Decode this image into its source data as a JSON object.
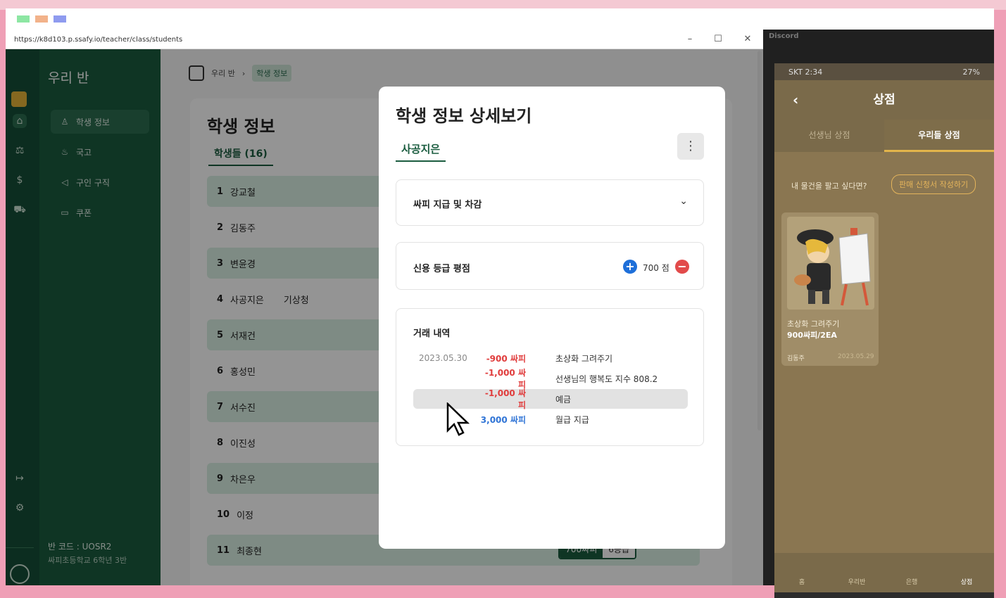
{
  "browser": {
    "url": "https://k8d103.p.ssafy.io/teacher/class/students"
  },
  "sidebar": {
    "title": "우리 반",
    "items": [
      {
        "label": "학생 정보",
        "icon": "person-icon",
        "active": true
      },
      {
        "label": "국고",
        "icon": "piggy-bank-icon"
      },
      {
        "label": "구인 구직",
        "icon": "megaphone-icon"
      },
      {
        "label": "쿠폰",
        "icon": "ticket-icon"
      }
    ],
    "class_code": "반 코드 : UOSR2",
    "school": "싸피초등학교 6학년 3반"
  },
  "breadcrumb": {
    "root": "우리 반",
    "current": "학생 정보"
  },
  "students_page": {
    "title": "학생 정보",
    "tab": "학생들 (16)",
    "rows": [
      {
        "no": "1",
        "name": "강교철"
      },
      {
        "no": "2",
        "name": "김동주"
      },
      {
        "no": "3",
        "name": "변윤경"
      },
      {
        "no": "4",
        "name": "사공지은",
        "extra": "기상청"
      },
      {
        "no": "5",
        "name": "서재건"
      },
      {
        "no": "6",
        "name": "홍성민"
      },
      {
        "no": "7",
        "name": "서수진"
      },
      {
        "no": "8",
        "name": "이진성"
      },
      {
        "no": "9",
        "name": "차은우"
      },
      {
        "no": "10",
        "name": "이정"
      },
      {
        "no": "11",
        "name": "최종현",
        "balance": "700싸피",
        "grade": "6등급"
      }
    ]
  },
  "modal": {
    "title": "학생 정보 상세보기",
    "student": "사공지은",
    "sections": {
      "payment": "싸피 지급 및 차감",
      "credit": {
        "label": "신용 등급 평점",
        "score": "700 점"
      },
      "history": {
        "label": "거래 내역",
        "rows": [
          {
            "date": "2023.05.30",
            "amount": "-900 싸피",
            "desc": "초상화 그려주기",
            "type": "neg"
          },
          {
            "date": "",
            "amount": "-1,000 싸피",
            "desc": "선생님의 행복도 지수 808.2",
            "type": "neg"
          },
          {
            "date": "",
            "amount": "-1,000 싸피",
            "desc": "예금",
            "type": "neg"
          },
          {
            "date": "",
            "amount": "3,000 싸피",
            "desc": "월급 지급",
            "type": "pos"
          }
        ]
      }
    }
  },
  "discord": {
    "title": "Discord"
  },
  "phone": {
    "status_left": "SKT 2:34",
    "status_right": "27%",
    "title": "상점",
    "tabs": [
      "선생님 상점",
      "우리들 상점"
    ],
    "sell_prompt": "내 물건을 팔고 싶다면?",
    "sell_button": "판매 신청서 작성하기",
    "item": {
      "name": "초상화 그려주기",
      "price": "900싸피/2EA",
      "seller": "김동주",
      "date": "2023.05.29"
    },
    "nav": [
      "홈",
      "우리반",
      "은행",
      "상점"
    ]
  },
  "colors": {
    "sidebar": "#1a5c3f",
    "accent": "#1a5c3f",
    "negative": "#e03c3c",
    "positive": "#2f74d6"
  }
}
